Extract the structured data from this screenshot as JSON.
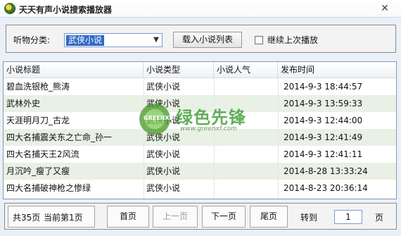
{
  "window": {
    "title": "天天有声小说搜索播放器",
    "close_symbol": "✕"
  },
  "toolbar": {
    "category_label": "听物分类:",
    "category_value": "武侠小说",
    "load_button": "载入小说列表",
    "continue_label": "继续上次播放",
    "continue_checked": false
  },
  "table": {
    "columns": [
      "小说标题",
      "小说类型",
      "小说人气",
      "发布时间"
    ],
    "rows": [
      [
        "碧血洗银枪_熊涛",
        "武侠小说",
        "",
        "2014-9-3 18:44:57"
      ],
      [
        "武林外史",
        "武侠小说",
        "",
        "2014-9-3 13:59:33"
      ],
      [
        "天涯明月刀_古龙",
        "武侠小说",
        "",
        "2014-9-3 12:44:00"
      ],
      [
        "四大名捕震关东之亡命_孙一",
        "武侠小说",
        "",
        "2014-9-3 12:41:49"
      ],
      [
        "四大名捕天王2风流",
        "武侠小说",
        "",
        "2014-9-3 12:41:11"
      ],
      [
        "月沉吟_瘦了又瘦",
        "武侠小说",
        "",
        "2014-8-28 13:33:24"
      ],
      [
        "四大名捕破神枪之惨绿",
        "武侠小说",
        "",
        "2014-8-23 20:36:14"
      ]
    ]
  },
  "watermark": {
    "name": "绿色先锋",
    "url": "www.greenxf.com",
    "logo_text": "GREENXF"
  },
  "pager": {
    "total": "共35页",
    "current": "当前第1页",
    "first": "首页",
    "prev": "上一页",
    "next": "下一页",
    "last": "尾页",
    "goto": "转到",
    "page_value": "1",
    "page_unit": "页"
  }
}
